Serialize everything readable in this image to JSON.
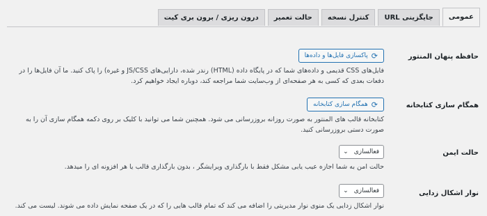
{
  "tabs": [
    {
      "label": "عمومی",
      "active": true
    },
    {
      "label": "جایگزینی URL",
      "active": false
    },
    {
      "label": "کنترل نسخه",
      "active": false
    },
    {
      "label": "حالت تعمیر",
      "active": false
    },
    {
      "label": "درون ریزی / برون بری کیت",
      "active": false
    }
  ],
  "settings": {
    "cache": {
      "label": "حافظه پنهان المنتور",
      "button": "پاکسازی فایل‌ها و داده‌ها",
      "desc": "فایل‌های CSS قدیمی و داده‌های شما که در پایگاه داده (HTML) رندر شده، دارایی‌های JS/CSS و غیره) را پاک کنید. ما آن فایل‌ها را در دفعات بعدی که کسی به هر صفحه‌ای از وب‌سایت شما مراجعه کند، دوباره ایجاد خواهیم کرد."
    },
    "sync": {
      "label": "همگام سازی کتابخانه",
      "button": "همگام سازی کتابخانه",
      "desc": "کتابخانه قالب های المنتور به صورت روزانه بروزرسانی می شود. همچنین شما می توانید با کلیک بر روی دکمه همگام سازی آن را به صورت دستی بروزرسانی کنید."
    },
    "safe_mode": {
      "label": "حالت ایمن",
      "value": "فعالسازی",
      "desc": "حالت امن به شما اجازه عیب یابی مشکل فقط با بارگذاری ویرایشگر ، بدون بارگذاری قالب یا هر افزونه ای را میدهد."
    },
    "debug_bar": {
      "label": "نوار اشکال زدایی",
      "value": "فعالسازی",
      "desc": "نوار اشکال زدایی یک منوی نوار مدیریتی را اضافه می کند که تمام قالب هایی را که در یک صفحه نمایش داده می شوند. لیست می کند."
    }
  },
  "icons": {
    "sync": "refresh-icon",
    "dropdown": "chevron-down-icon"
  }
}
